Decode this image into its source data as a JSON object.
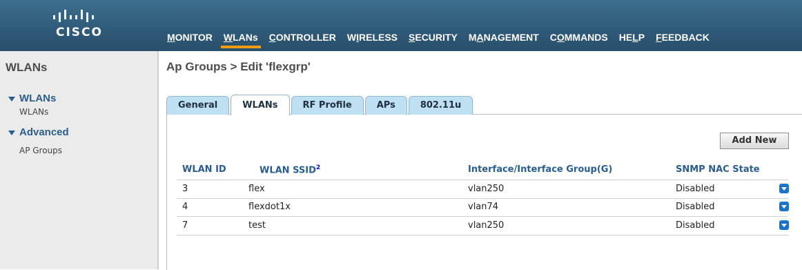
{
  "brand": {
    "logo_text": "CISCO"
  },
  "nav": [
    {
      "pre": "",
      "u": "M",
      "post": "ONITOR",
      "active": false
    },
    {
      "pre": "",
      "u": "W",
      "post": "LANs",
      "active": true
    },
    {
      "pre": "",
      "u": "C",
      "post": "ONTROLLER",
      "active": false
    },
    {
      "pre": "W",
      "u": "I",
      "post": "RELESS",
      "active": false
    },
    {
      "pre": "",
      "u": "S",
      "post": "ECURITY",
      "active": false
    },
    {
      "pre": "M",
      "u": "A",
      "post": "NAGEMENT",
      "active": false
    },
    {
      "pre": "C",
      "u": "O",
      "post": "MMANDS",
      "active": false
    },
    {
      "pre": "HE",
      "u": "L",
      "post": "P",
      "active": false
    },
    {
      "pre": "",
      "u": "F",
      "post": "EEDBACK",
      "active": false
    }
  ],
  "sidebar": {
    "title": "WLANs",
    "groups": [
      {
        "label": "WLANs",
        "items": [
          "WLANs"
        ]
      },
      {
        "label": "Advanced",
        "items": [
          "AP Groups"
        ]
      }
    ]
  },
  "page": {
    "title": "Ap Groups > Edit  'flexgrp'"
  },
  "tabs": [
    "General",
    "WLANs",
    "RF Profile",
    "APs",
    "802.11u"
  ],
  "active_tab": "WLANs",
  "add_button": "Add New",
  "table": {
    "headers": [
      "WLAN ID",
      "WLAN SSID",
      "Interface/Interface Group(G)",
      "SNMP NAC State"
    ],
    "ssid_footnote": "2",
    "rows": [
      {
        "id": "3",
        "ssid": "flex",
        "iface": "vlan250",
        "nac": "Disabled"
      },
      {
        "id": "4",
        "ssid": "flexdot1x",
        "iface": "vlan74",
        "nac": "Disabled"
      },
      {
        "id": "7",
        "ssid": "test",
        "iface": "vlan250",
        "nac": "Disabled"
      }
    ]
  },
  "colors": {
    "topbar": "#2f5a78",
    "accent": "#f39c12",
    "link": "#2a5d8f",
    "tab": "#bfe0f3"
  }
}
